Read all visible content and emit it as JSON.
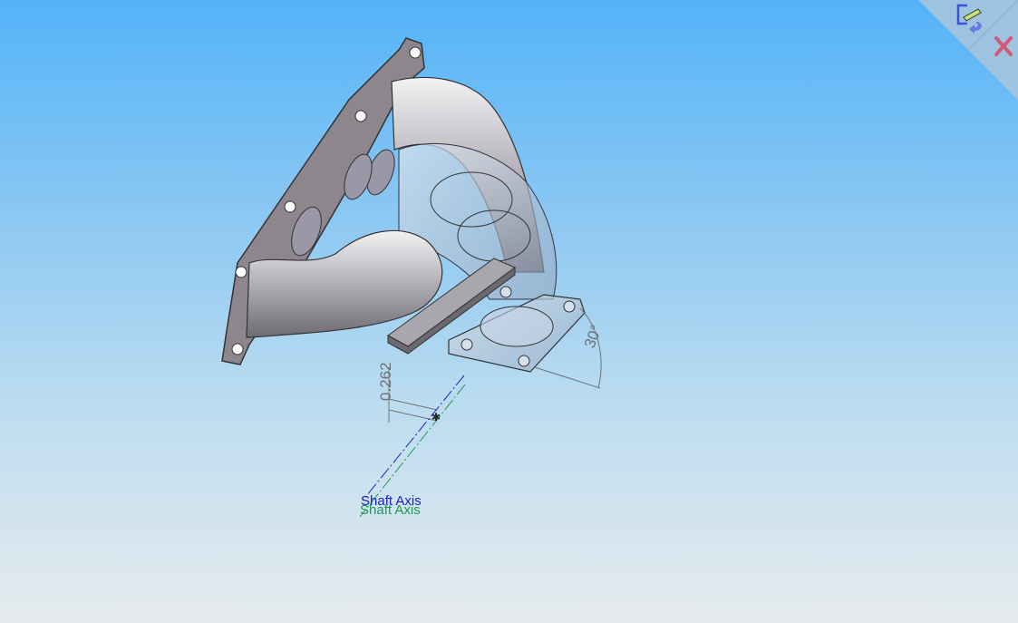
{
  "confirmation_corner": {
    "exit_sketch_icon": "sketch-pencil-icon",
    "cancel_icon": "close-x-icon"
  },
  "annotations": {
    "linear_dimension": "0.262",
    "angular_dimension": "30°",
    "axis_label_1": "Shaft Axis",
    "axis_label_2": "Shaft Axis"
  },
  "colors": {
    "axis_blue": "#1a22c8",
    "axis_green": "#1e9a52",
    "cancel_red": "#d05a7a",
    "dimension_gray": "#6e7478"
  }
}
